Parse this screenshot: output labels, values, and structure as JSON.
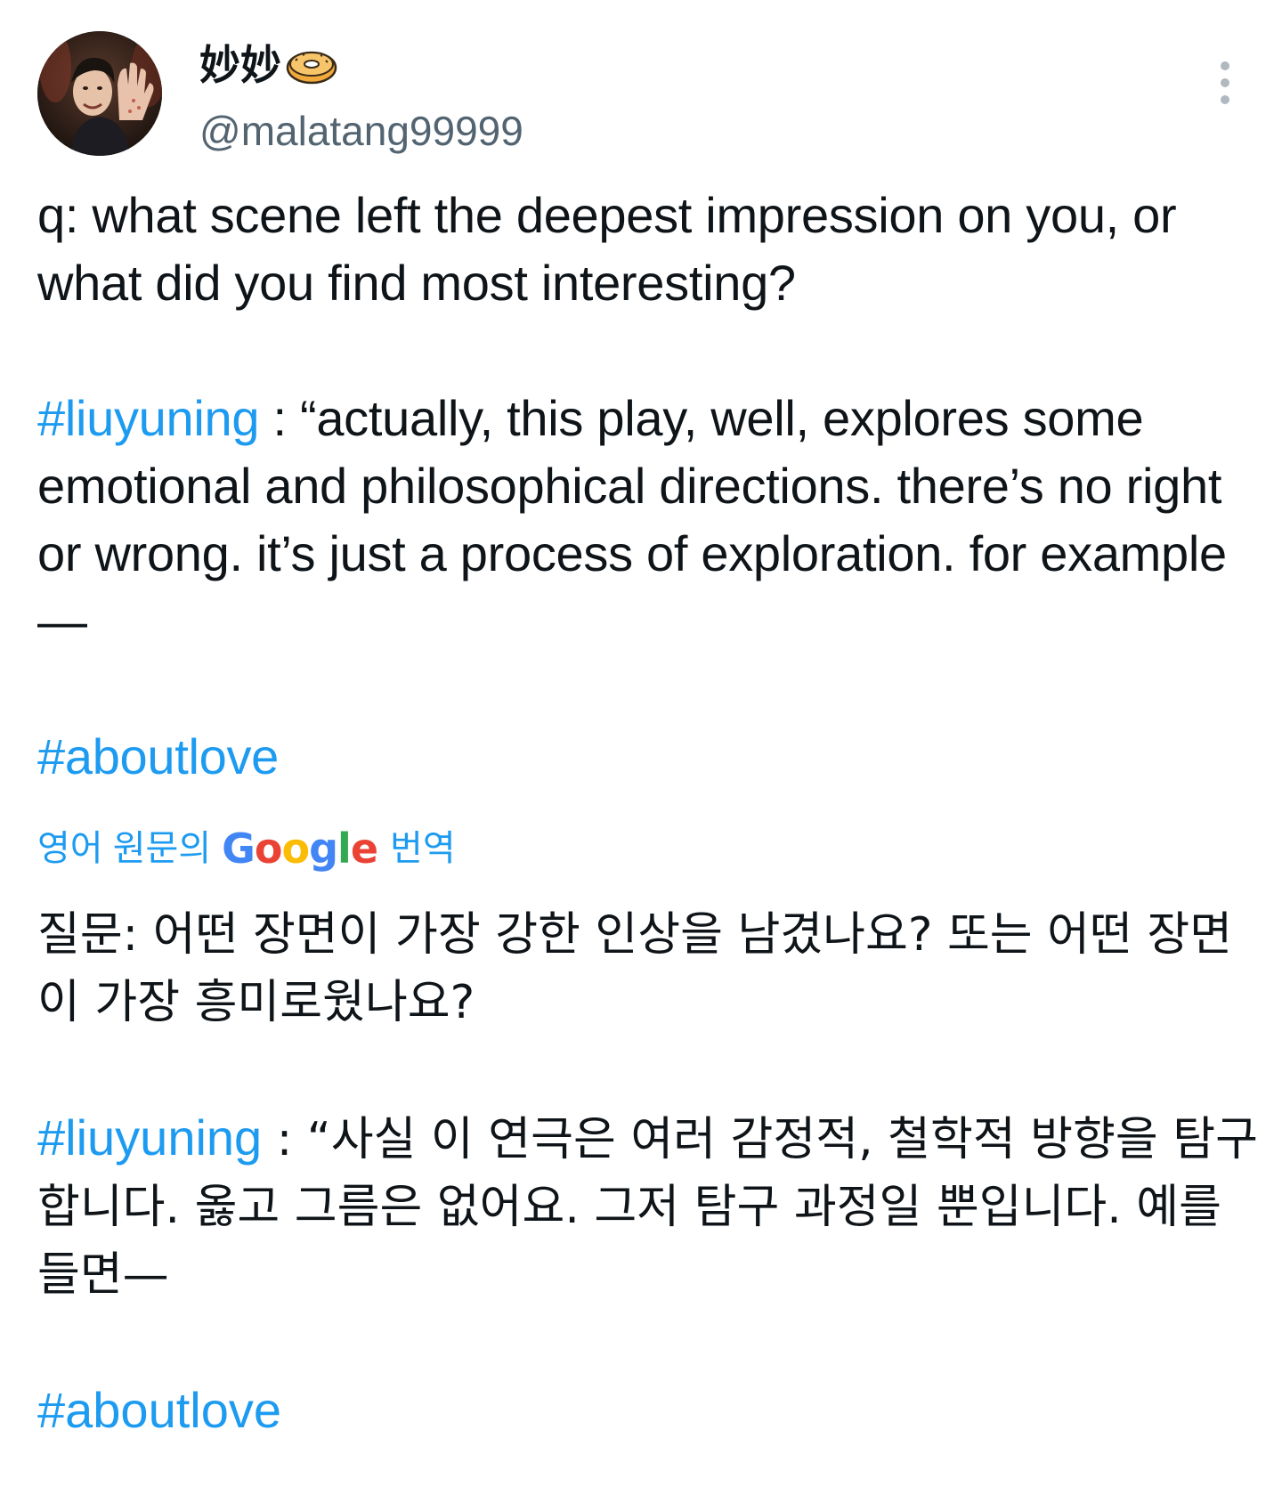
{
  "author": {
    "display_name": "妙妙",
    "handle": "@malatang99999",
    "avatar_icon": "profile-photo",
    "name_emoji_icon": "bagel-icon"
  },
  "original": {
    "question": "q: what scene left the deepest impression on you, or what did you find most interesting?",
    "tag1": "#liuyuning",
    "answer": " : “actually, this play, well, explores some emotional and philosophical directions. there’s no right or wrong. it’s just a process of exploration. for example—",
    "tag2": "#aboutlove"
  },
  "translation_bar": {
    "prefix": "영어 원문의",
    "logo": "Google",
    "suffix": "번역"
  },
  "translated": {
    "question": "질문: 어떤 장면이 가장 강한 인상을 남겼나요? 또는 어떤 장면이 가장 흥미로웠나요?",
    "tag1": "#liuyuning",
    "answer": " : “사실 이 연극은 여러 감정적, 철학적 방향을 탐구합니다. 옳고 그름은 없어요. 그저 탐구 과정일 뿐입니다. 예를 들면—",
    "tag2": "#aboutlove"
  },
  "colors": {
    "hashtag": "#1d9bf0",
    "text": "#0f1419",
    "secondary": "#536471"
  }
}
